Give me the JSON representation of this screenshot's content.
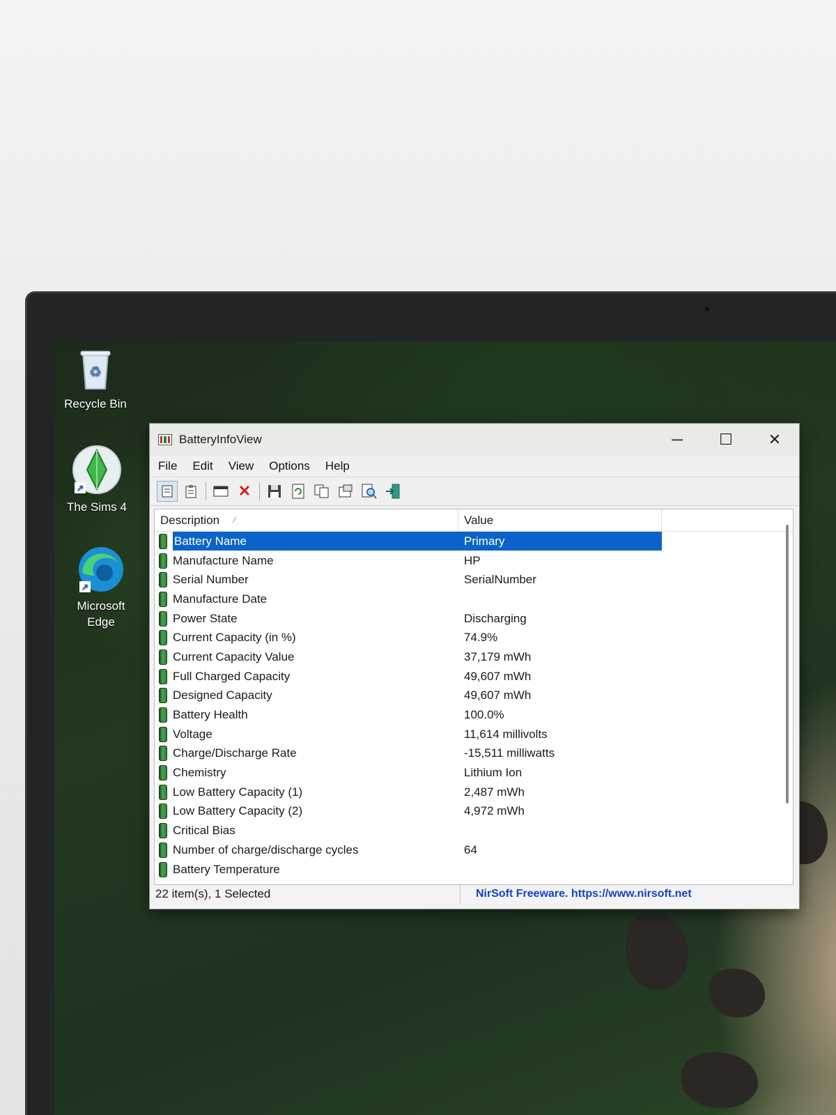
{
  "desktop": {
    "icons": [
      {
        "label": "Recycle Bin"
      },
      {
        "label": "The Sims 4"
      },
      {
        "label": "Microsoft Edge"
      }
    ]
  },
  "window": {
    "title": "BatteryInfoView",
    "controls": {
      "minimize": "─",
      "maximize": "☐",
      "close": "✕"
    },
    "menu": [
      "File",
      "Edit",
      "View",
      "Options",
      "Help"
    ],
    "columns": {
      "description": "Description",
      "value": "Value"
    },
    "rows": [
      {
        "description": "Battery Name",
        "value": "Primary"
      },
      {
        "description": "Manufacture Name",
        "value": "HP"
      },
      {
        "description": "Serial Number",
        "value": "SerialNumber"
      },
      {
        "description": "Manufacture Date",
        "value": ""
      },
      {
        "description": "Power State",
        "value": "Discharging"
      },
      {
        "description": "Current Capacity (in %)",
        "value": "74.9%"
      },
      {
        "description": "Current Capacity Value",
        "value": "37,179 mWh"
      },
      {
        "description": "Full Charged Capacity",
        "value": "49,607 mWh"
      },
      {
        "description": "Designed Capacity",
        "value": "49,607 mWh"
      },
      {
        "description": "Battery Health",
        "value": "100.0%"
      },
      {
        "description": "Voltage",
        "value": "11,614 millivolts"
      },
      {
        "description": "Charge/Discharge Rate",
        "value": "-15,511 milliwatts"
      },
      {
        "description": "Chemistry",
        "value": "Lithium Ion"
      },
      {
        "description": "Low Battery Capacity (1)",
        "value": "2,487 mWh"
      },
      {
        "description": "Low Battery Capacity (2)",
        "value": "4,972 mWh"
      },
      {
        "description": "Critical Bias",
        "value": ""
      },
      {
        "description": "Number of charge/discharge cycles",
        "value": "64"
      },
      {
        "description": "Battery Temperature",
        "value": ""
      }
    ],
    "status": {
      "count": "22 item(s), 1 Selected",
      "link": "NirSoft Freeware. https://www.nirsoft.net"
    }
  },
  "colors": {
    "selection": "#0a63c7",
    "link": "#1a3fc8"
  }
}
